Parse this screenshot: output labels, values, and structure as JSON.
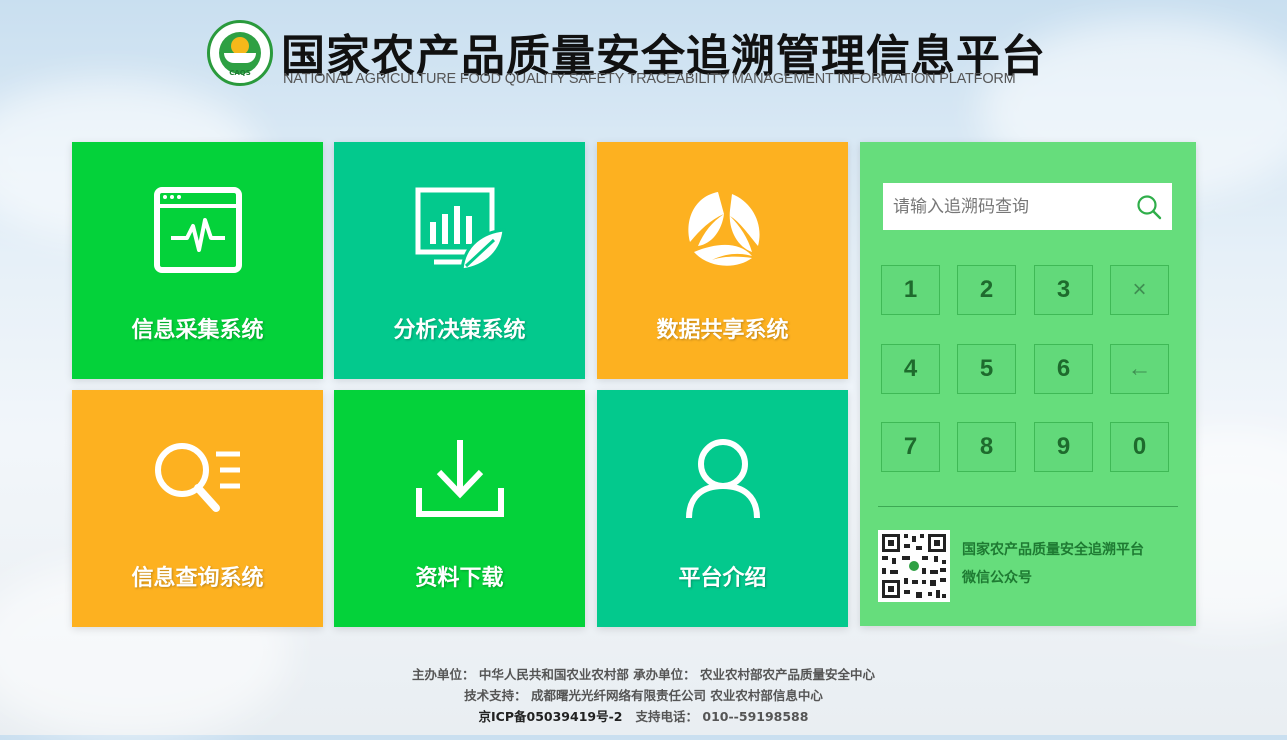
{
  "header": {
    "title": "国家农产品质量安全追溯管理信息平台",
    "subtitle": "NATIONAL AGRICULTURE FOOD QUALITY SAFETY TRACEABILITY MANAGEMENT INFORMATION PLATFORM",
    "logo_text": "CAQS"
  },
  "tiles": [
    {
      "label": "信息采集系统",
      "icon": "monitor-pulse-icon",
      "color": "#04d23a"
    },
    {
      "label": "分析决策系统",
      "icon": "chart-leaf-icon",
      "color": "#03c98d"
    },
    {
      "label": "数据共享系统",
      "icon": "recycle-leaves-icon",
      "color": "#fdb120"
    },
    {
      "label": "信息查询系统",
      "icon": "search-list-icon",
      "color": "#fdb120"
    },
    {
      "label": "资料下载",
      "icon": "download-icon",
      "color": "#04d23a"
    },
    {
      "label": "平台介绍",
      "icon": "user-icon",
      "color": "#03c98d"
    }
  ],
  "query_panel": {
    "search_placeholder": "请输入追溯码查询",
    "search_value": "",
    "keys": [
      "1",
      "2",
      "3",
      "×",
      "4",
      "5",
      "6",
      "←",
      "7",
      "8",
      "9",
      "0"
    ],
    "wechat_line1": "国家农产品质量安全追溯平台",
    "wechat_line2": "微信公众号",
    "panel_color": "#66dd7c"
  },
  "footer": {
    "line1": "主办单位： 中华人民共和国农业农村部   承办单位： 农业农村部农产品质量安全中心",
    "line2": "技术支持： 成都曙光光纤网络有限责任公司   农业农村部信息中心",
    "icp": "京ICP备05039419号-2",
    "phone": "支持电话： 010--59198588"
  }
}
